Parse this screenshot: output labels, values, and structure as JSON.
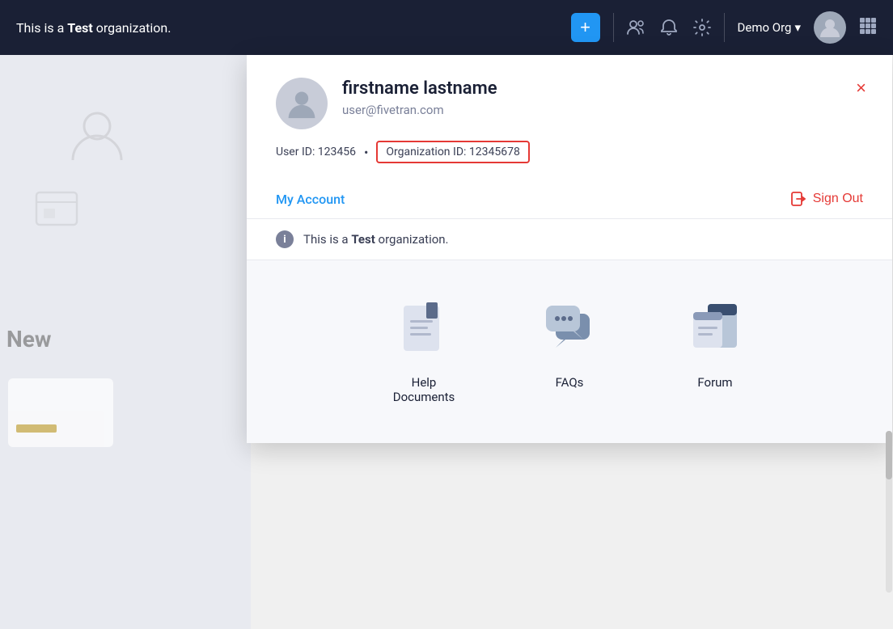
{
  "navbar": {
    "brand_text": "This is a ",
    "brand_bold": "Test",
    "brand_suffix": " organization.",
    "add_button_label": "+",
    "org_name": "Demo Org",
    "org_chevron": "▾"
  },
  "dropdown": {
    "user": {
      "name": "firstname lastname",
      "email": "user@fivetran.com",
      "user_id_label": "User ID: 123456",
      "dot": "•",
      "org_id_label": "Organization ID: 12345678"
    },
    "my_account_label": "My Account",
    "sign_out_label": "Sign Out",
    "test_org_notice": "This is a ",
    "test_org_bold": "Test",
    "test_org_suffix": " organization.",
    "close_label": "×"
  },
  "help": {
    "items": [
      {
        "label": "Help\nDocuments",
        "icon": "help-docs-icon"
      },
      {
        "label": "FAQs",
        "icon": "faqs-icon"
      },
      {
        "label": "Forum",
        "icon": "forum-icon"
      }
    ]
  },
  "background": {
    "new_label": "New"
  }
}
